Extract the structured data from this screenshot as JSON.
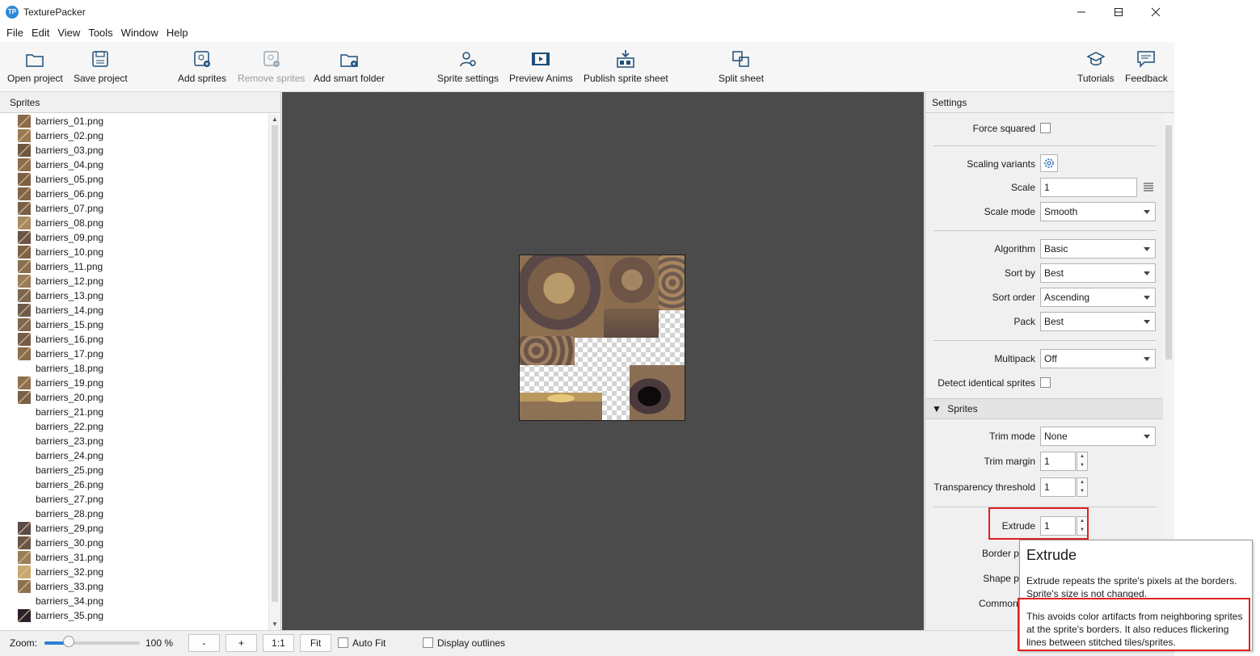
{
  "window": {
    "title": "TexturePacker",
    "logo_text": "TP"
  },
  "menu": [
    "File",
    "Edit",
    "View",
    "Tools",
    "Window",
    "Help"
  ],
  "toolbar": {
    "open_project": "Open project",
    "save_project": "Save project",
    "add_sprites": "Add sprites",
    "remove_sprites": "Remove sprites",
    "add_smart_folder": "Add smart folder",
    "sprite_settings": "Sprite settings",
    "preview_anims": "Preview Anims",
    "publish_sprite_sheet": "Publish sprite sheet",
    "split_sheet": "Split sheet",
    "tutorials": "Tutorials",
    "feedback": "Feedback"
  },
  "sprites_panel": {
    "header": "Sprites",
    "items": [
      {
        "name": "barriers_01.png",
        "thumb": "#8a6a48"
      },
      {
        "name": "barriers_02.png",
        "thumb": "#9a7a55"
      },
      {
        "name": "barriers_03.png",
        "thumb": "#6e5640"
      },
      {
        "name": "barriers_04.png",
        "thumb": "#8c6c4c"
      },
      {
        "name": "barriers_05.png",
        "thumb": "#7b5f45"
      },
      {
        "name": "barriers_06.png",
        "thumb": "#826548"
      },
      {
        "name": "barriers_07.png",
        "thumb": "#7a6048"
      },
      {
        "name": "barriers_08.png",
        "thumb": "#a88a62"
      },
      {
        "name": "barriers_09.png",
        "thumb": "#6a5448"
      },
      {
        "name": "barriers_10.png",
        "thumb": "#7e6246"
      },
      {
        "name": "barriers_11.png",
        "thumb": "#8a6e52"
      },
      {
        "name": "barriers_12.png",
        "thumb": "#9a7c58"
      },
      {
        "name": "barriers_13.png",
        "thumb": "#7c6650"
      },
      {
        "name": "barriers_14.png",
        "thumb": "#6f5a4a"
      },
      {
        "name": "barriers_15.png",
        "thumb": "#80664e"
      },
      {
        "name": "barriers_16.png",
        "thumb": "#745c48"
      },
      {
        "name": "barriers_17.png",
        "thumb": "#8a6c4e"
      },
      {
        "name": "barriers_18.png",
        "thumb": ""
      },
      {
        "name": "barriers_19.png",
        "thumb": "#8e7050"
      },
      {
        "name": "barriers_20.png",
        "thumb": "#7a6048"
      },
      {
        "name": "barriers_21.png",
        "thumb": ""
      },
      {
        "name": "barriers_22.png",
        "thumb": ""
      },
      {
        "name": "barriers_23.png",
        "thumb": ""
      },
      {
        "name": "barriers_24.png",
        "thumb": ""
      },
      {
        "name": "barriers_25.png",
        "thumb": ""
      },
      {
        "name": "barriers_26.png",
        "thumb": ""
      },
      {
        "name": "barriers_27.png",
        "thumb": ""
      },
      {
        "name": "barriers_28.png",
        "thumb": ""
      },
      {
        "name": "barriers_29.png",
        "thumb": "#5a4a48"
      },
      {
        "name": "barriers_30.png",
        "thumb": "#6a5648"
      },
      {
        "name": "barriers_31.png",
        "thumb": "#9a7e5a"
      },
      {
        "name": "barriers_32.png",
        "thumb": "#c9a76e"
      },
      {
        "name": "barriers_33.png",
        "thumb": "#8e7050"
      },
      {
        "name": "barriers_34.png",
        "thumb": ""
      },
      {
        "name": "barriers_35.png",
        "thumb": "#2a2228"
      }
    ]
  },
  "bottom_bar": {
    "zoom_label": "Zoom:",
    "zoom_value": "100 %",
    "zoom_slider_fraction": 0.25,
    "zoom_out": "-",
    "zoom_in": "+",
    "one_to_one": "1:1",
    "fit": "Fit",
    "auto_fit": "Auto Fit",
    "display_outlines": "Display outlines"
  },
  "settings": {
    "header": "Settings",
    "force_squared": "Force squared",
    "scaling_variants": "Scaling variants",
    "scale_label": "Scale",
    "scale_value": "1",
    "scale_mode_label": "Scale mode",
    "scale_mode_value": "Smooth",
    "algorithm_label": "Algorithm",
    "algorithm_value": "Basic",
    "sort_by_label": "Sort by",
    "sort_by_value": "Best",
    "sort_order_label": "Sort order",
    "sort_order_value": "Ascending",
    "pack_label": "Pack",
    "pack_value": "Best",
    "multipack_label": "Multipack",
    "multipack_value": "Off",
    "detect_identical_label": "Detect identical sprites",
    "sprites_section": "Sprites",
    "trim_mode_label": "Trim mode",
    "trim_mode_value": "None",
    "trim_margin_label": "Trim margin",
    "trim_margin_value": "1",
    "transparency_threshold_label": "Transparency threshold",
    "transparency_threshold_value": "1",
    "extrude_label": "Extrude",
    "extrude_value": "1",
    "border_padding_label": "Border padd",
    "shape_padding_label": "Shape padd",
    "common_divisor_label": "Common divi"
  },
  "tooltip": {
    "title": "Extrude",
    "para1": "Extrude repeats the sprite's pixels at the borders. Sprite's size is not changed.",
    "para2": "This avoids color artifacts from neighboring sprites at the sprite's borders. It also reduces flickering lines between stitched tiles/sprites."
  },
  "colors": {
    "highlight": "#e02020",
    "accent": "#2f7fd3",
    "canvas_bg": "#4a4a4a"
  }
}
